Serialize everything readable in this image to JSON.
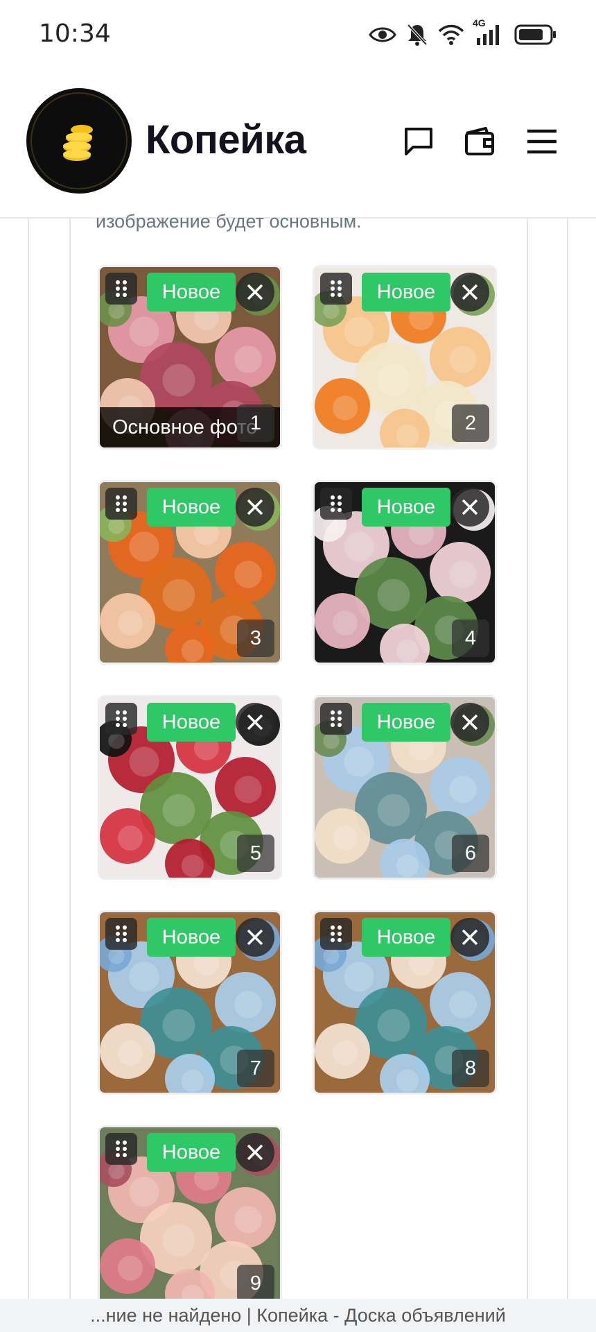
{
  "status_bar": {
    "time": "10:34",
    "network": "4G",
    "icons": [
      "eye-icon",
      "bell-off-icon",
      "wifi-icon",
      "signal-icon",
      "battery-icon"
    ]
  },
  "header": {
    "brand": "Копейка",
    "logo_icon": "coins-icon",
    "actions": [
      "chat-icon",
      "wallet-icon",
      "menu-icon"
    ]
  },
  "upload": {
    "hint": "изображение будет основным.",
    "new_label": "Новое",
    "main_photo_label": "Основное фото",
    "photos": [
      {
        "number": "1",
        "is_main": true
      },
      {
        "number": "2",
        "is_main": false
      },
      {
        "number": "3",
        "is_main": false
      },
      {
        "number": "4",
        "is_main": false
      },
      {
        "number": "5",
        "is_main": false
      },
      {
        "number": "6",
        "is_main": false
      },
      {
        "number": "7",
        "is_main": false
      },
      {
        "number": "8",
        "is_main": false
      },
      {
        "number": "9",
        "is_main": false
      }
    ]
  },
  "bottom_bar": {
    "page_title": "...ние не найдено | Копейка - Доска объявлений"
  },
  "colors": {
    "accent_green": "#2ec866",
    "brand_gold": "#f2c21b",
    "logo_bg": "#0d0d0d"
  }
}
